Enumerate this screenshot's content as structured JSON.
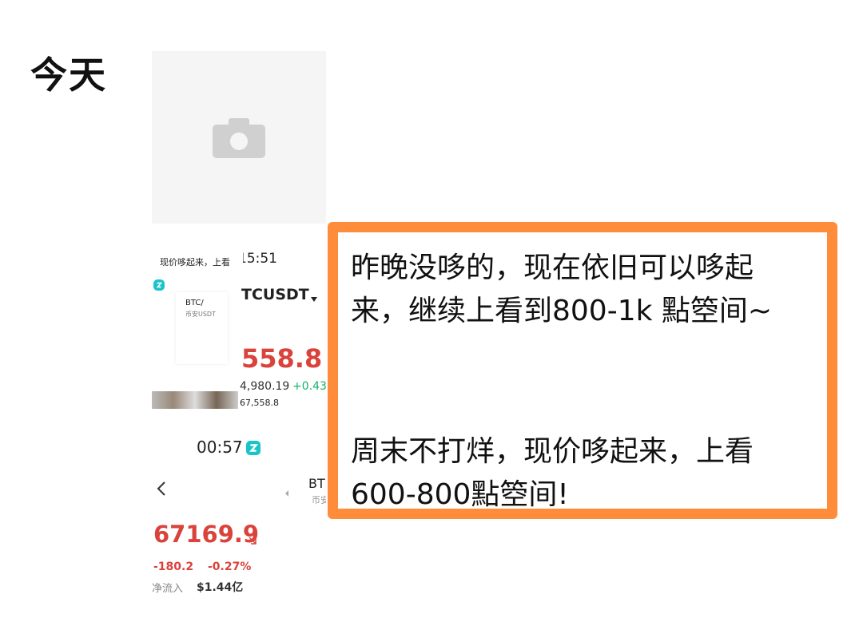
{
  "feed": {
    "date_label": "今天"
  },
  "photo_placeholder": {
    "icon": "camera-icon"
  },
  "screenshot_a": {
    "title_snippet": "现价哆起来，上看",
    "time": "15:51",
    "pair_name": "TCUSDT",
    "pair_dropdown_icon": "caret-down-icon",
    "side_name": "BTC/",
    "side_sub": "币安USDT",
    "price_big": "558.8",
    "sub_value": "4,980.19",
    "sub_change": "+0.43",
    "bottom_value": "67,558.8",
    "brand_color": "#19c4c8"
  },
  "screenshot_b": {
    "time": "00:57",
    "back_icon": "chevron-left-icon",
    "pair_name": "BT",
    "pair_sub": "币安",
    "price": "67169.9",
    "change_abs": "-180.2",
    "change_pct": "-0.27%",
    "flow_label": "净流入",
    "flow_value": "$1.44亿",
    "price_color": "#d9433b"
  },
  "callout": {
    "line1": "昨晚没哆的，现在依旧可以哆起",
    "line2": "来，继续上看到800-1k 點箜间~",
    "line3": "周末不打烊，现价哆起来，上看",
    "line4": "600-800點箜间!",
    "border_color": "#ff8c3a"
  }
}
